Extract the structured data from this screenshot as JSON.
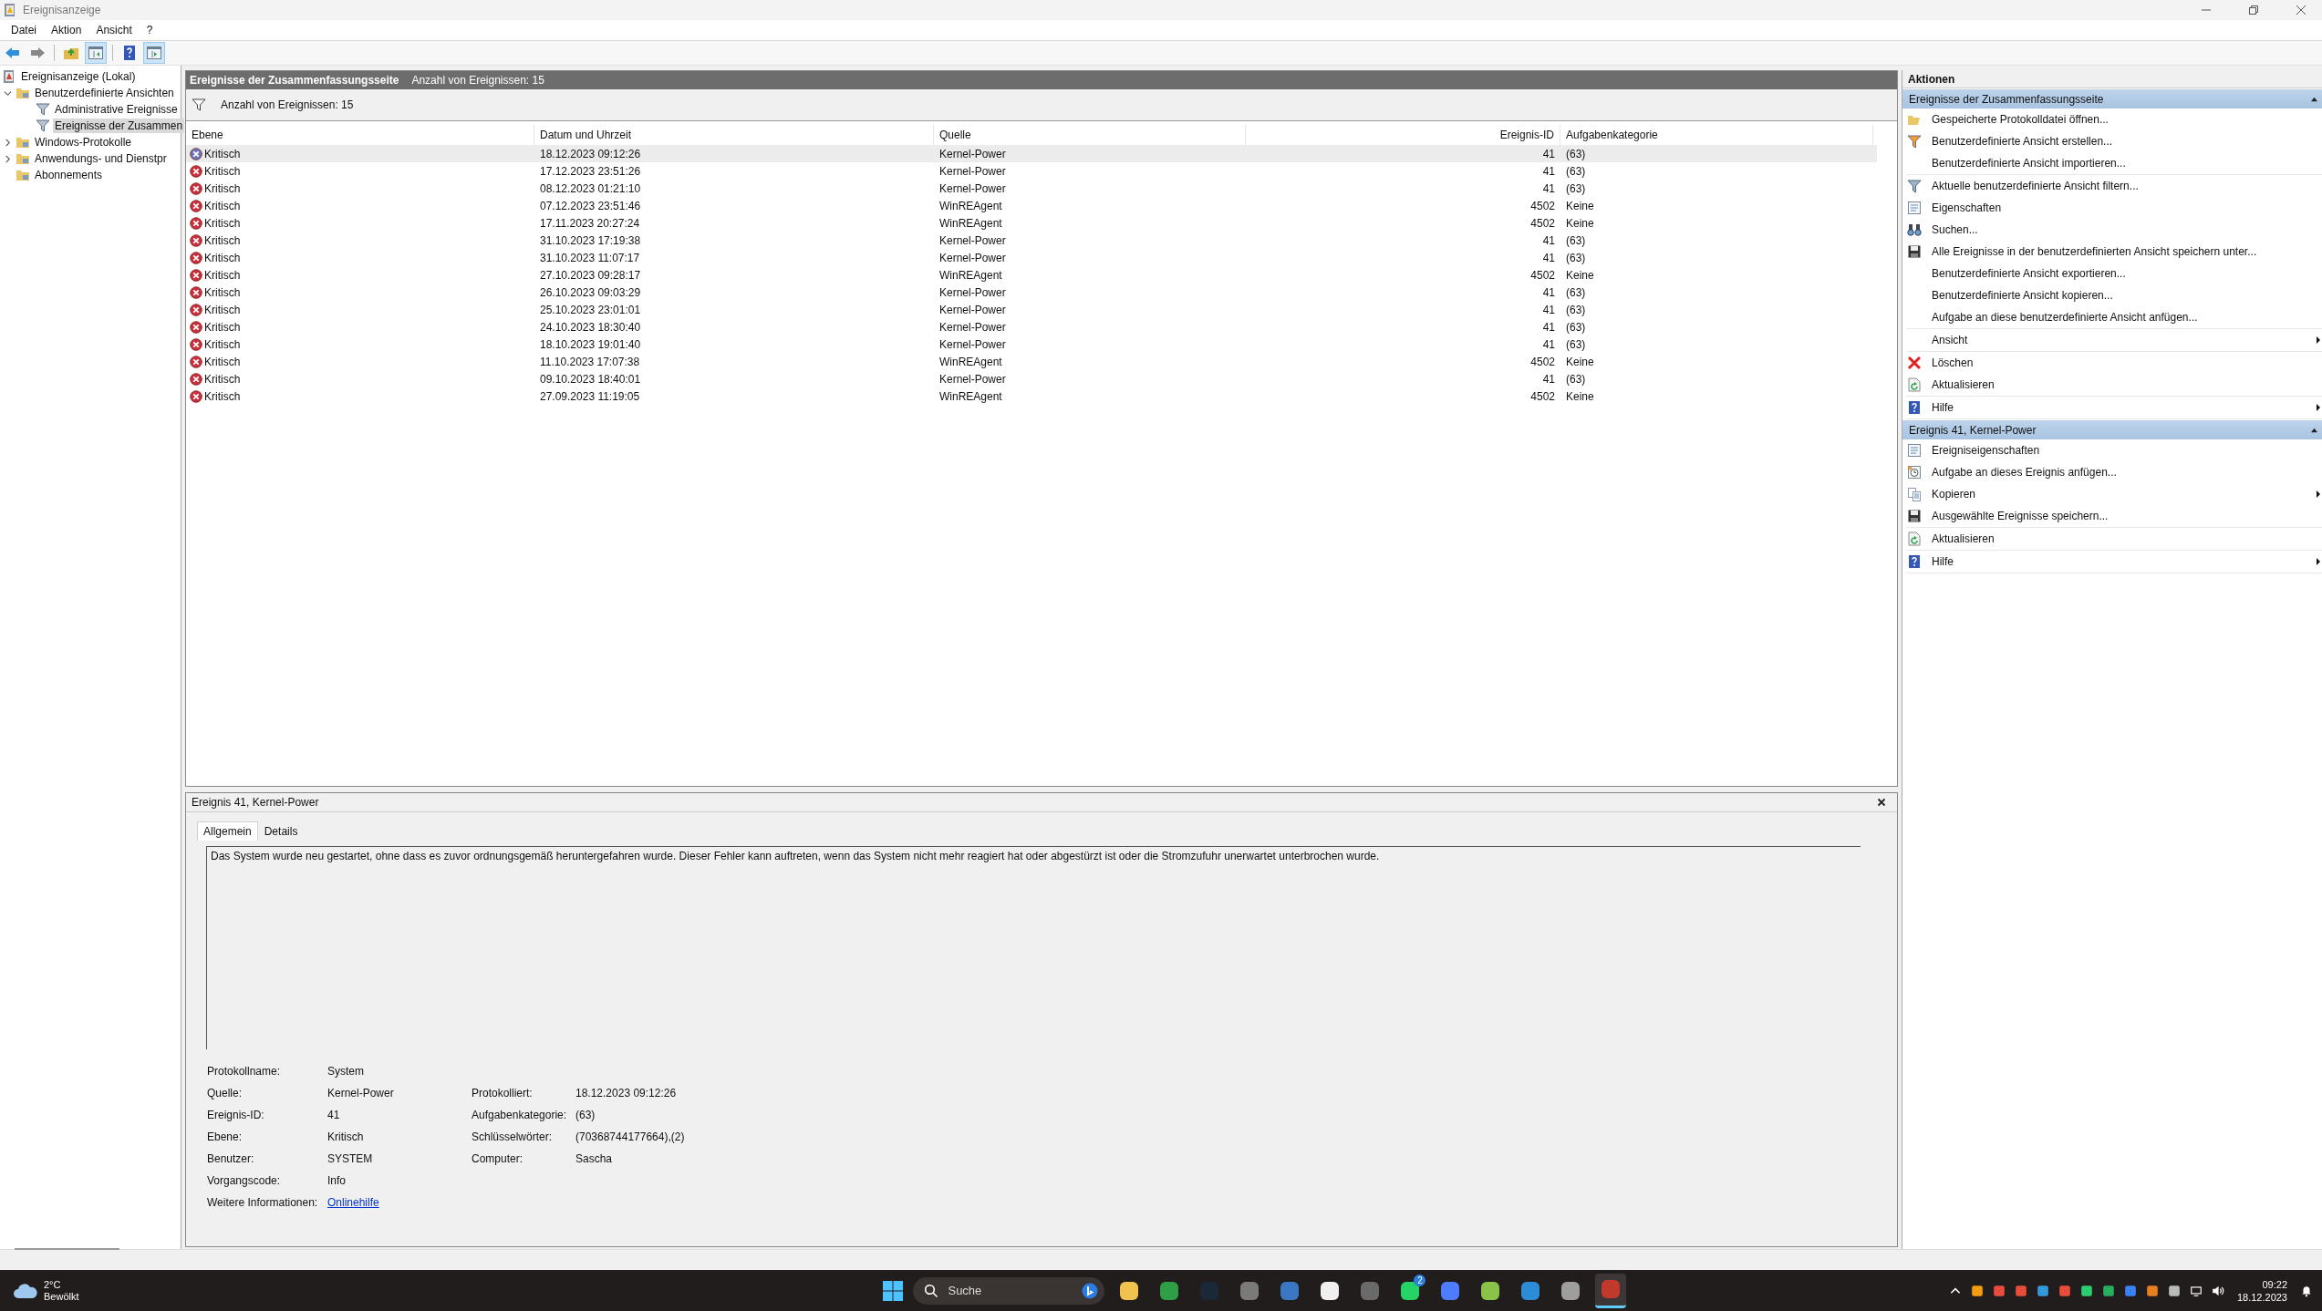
{
  "window": {
    "title": "Ereignisanzeige"
  },
  "menu": [
    "Datei",
    "Aktion",
    "Ansicht",
    "?"
  ],
  "toolbar": [
    {
      "kind": "back",
      "pressed": false
    },
    {
      "kind": "forward",
      "pressed": false
    },
    {
      "kind": "up",
      "pressed": false
    },
    {
      "kind": "tree-pane",
      "pressed": true
    },
    {
      "kind": "help",
      "pressed": false
    },
    {
      "kind": "action-pane",
      "pressed": true
    }
  ],
  "tree": [
    {
      "label": "Ereignisanzeige (Lokal)",
      "kind": "root",
      "selected": false,
      "children": [
        {
          "label": "Benutzerdefinierte Ansichten",
          "kind": "folder",
          "expanded": true,
          "selected": false,
          "children": [
            {
              "label": "Administrative Ereignisse",
              "kind": "funnel",
              "selected": false
            },
            {
              "label": "Ereignisse der Zusammen",
              "kind": "funnel",
              "selected": true
            }
          ]
        },
        {
          "label": "Windows-Protokolle",
          "kind": "folder",
          "expanded": false,
          "selected": false
        },
        {
          "label": "Anwendungs- und Dienstpr",
          "kind": "folder",
          "expanded": false,
          "selected": false
        },
        {
          "label": "Abonnements",
          "kind": "folder",
          "selected": false
        }
      ]
    }
  ],
  "view": {
    "title": "Ereignisse der Zusammenfassungsseite",
    "count": "Anzahl von Ereignissen: 15",
    "filter_text": "Anzahl von Ereignissen: 15"
  },
  "table": {
    "columns": [
      {
        "label": "Ebene",
        "numeric": false
      },
      {
        "label": "Datum und Uhrzeit",
        "numeric": false
      },
      {
        "label": "Quelle",
        "numeric": false
      },
      {
        "label": "Ereignis-ID",
        "numeric": true
      },
      {
        "label": "Aufgabenkategorie",
        "numeric": false
      }
    ],
    "rows": [
      {
        "severity": "Kritisch",
        "date": "18.12.2023 09:12:26",
        "source": "Kernel-Power",
        "id": "41",
        "category": "(63)",
        "selected": true
      },
      {
        "severity": "Kritisch",
        "date": "17.12.2023 23:51:26",
        "source": "Kernel-Power",
        "id": "41",
        "category": "(63)",
        "selected": false
      },
      {
        "severity": "Kritisch",
        "date": "08.12.2023 01:21:10",
        "source": "Kernel-Power",
        "id": "41",
        "category": "(63)",
        "selected": false
      },
      {
        "severity": "Kritisch",
        "date": "07.12.2023 23:51:46",
        "source": "WinREAgent",
        "id": "4502",
        "category": "Keine",
        "selected": false
      },
      {
        "severity": "Kritisch",
        "date": "17.11.2023 20:27:24",
        "source": "WinREAgent",
        "id": "4502",
        "category": "Keine",
        "selected": false
      },
      {
        "severity": "Kritisch",
        "date": "31.10.2023 17:19:38",
        "source": "Kernel-Power",
        "id": "41",
        "category": "(63)",
        "selected": false
      },
      {
        "severity": "Kritisch",
        "date": "31.10.2023 11:07:17",
        "source": "Kernel-Power",
        "id": "41",
        "category": "(63)",
        "selected": false
      },
      {
        "severity": "Kritisch",
        "date": "27.10.2023 09:28:17",
        "source": "WinREAgent",
        "id": "4502",
        "category": "Keine",
        "selected": false
      },
      {
        "severity": "Kritisch",
        "date": "26.10.2023 09:03:29",
        "source": "Kernel-Power",
        "id": "41",
        "category": "(63)",
        "selected": false
      },
      {
        "severity": "Kritisch",
        "date": "25.10.2023 23:01:01",
        "source": "Kernel-Power",
        "id": "41",
        "category": "(63)",
        "selected": false
      },
      {
        "severity": "Kritisch",
        "date": "24.10.2023 18:30:40",
        "source": "Kernel-Power",
        "id": "41",
        "category": "(63)",
        "selected": false
      },
      {
        "severity": "Kritisch",
        "date": "18.10.2023 19:01:40",
        "source": "Kernel-Power",
        "id": "41",
        "category": "(63)",
        "selected": false
      },
      {
        "severity": "Kritisch",
        "date": "11.10.2023 17:07:38",
        "source": "WinREAgent",
        "id": "4502",
        "category": "Keine",
        "selected": false
      },
      {
        "severity": "Kritisch",
        "date": "09.10.2023 18:40:01",
        "source": "Kernel-Power",
        "id": "41",
        "category": "(63)",
        "selected": false
      },
      {
        "severity": "Kritisch",
        "date": "27.09.2023 11:19:05",
        "source": "WinREAgent",
        "id": "4502",
        "category": "Keine",
        "selected": false
      }
    ]
  },
  "detail": {
    "title": "Ereignis 41, Kernel-Power",
    "tabs": [
      {
        "label": "Allgemein",
        "selected": true
      },
      {
        "label": "Details",
        "selected": false
      }
    ],
    "description": "Das System wurde neu gestartet, ohne dass es zuvor ordnungsgemäß heruntergefahren wurde. Dieser Fehler kann auftreten, wenn das System nicht mehr reagiert hat oder abgestürzt ist oder die Stromzufuhr unerwartet unterbrochen wurde.",
    "rows": [
      {
        "left": {
          "label": "Protokollname:",
          "value": "System"
        }
      },
      {
        "left": {
          "label": "Quelle:",
          "value": "Kernel-Power"
        },
        "right": {
          "label": "Protokolliert:",
          "value": "18.12.2023 09:12:26"
        }
      },
      {
        "left": {
          "label": "Ereignis-ID:",
          "value": "41"
        },
        "right": {
          "label": "Aufgabenkategorie:",
          "value": "(63)"
        }
      },
      {
        "left": {
          "label": "Ebene:",
          "value": "Kritisch"
        },
        "right": {
          "label": "Schlüsselwörter:",
          "value": "(70368744177664),(2)"
        }
      },
      {
        "left": {
          "label": "Benutzer:",
          "value": "SYSTEM"
        },
        "right": {
          "label": "Computer:",
          "value": "Sascha"
        }
      },
      {
        "left": {
          "label": "Vorgangscode:",
          "value": "Info"
        }
      },
      {
        "left": {
          "label": "Weitere Informationen:",
          "value": "Onlinehilfe",
          "link": true
        }
      }
    ]
  },
  "actions": {
    "title": "Aktionen",
    "sections": [
      {
        "title": "Ereignisse der Zusammenfassungsseite",
        "expanded": true,
        "groups": [
          [
            {
              "label": "Gespeicherte Protokolldatei öffnen...",
              "kind": "folder",
              "submenu": false
            },
            {
              "label": "Benutzerdefinierte Ansicht erstellen...",
              "kind": "funnel-color",
              "submenu": false
            },
            {
              "label": "Benutzerdefinierte Ansicht importieren...",
              "kind": "none",
              "submenu": false
            }
          ],
          [
            {
              "label": "Aktuelle benutzerdefinierte Ansicht filtern...",
              "kind": "funnel",
              "submenu": false
            },
            {
              "label": "Eigenschaften",
              "kind": "properties",
              "submenu": false
            },
            {
              "label": "Suchen...",
              "kind": "binoculars",
              "submenu": false
            },
            {
              "label": "Alle Ereignisse in der benutzerdefinierten Ansicht speichern unter...",
              "kind": "disk",
              "submenu": false
            },
            {
              "label": "Benutzerdefinierte Ansicht exportieren...",
              "kind": "none",
              "submenu": false
            },
            {
              "label": "Benutzerdefinierte Ansicht kopieren...",
              "kind": "none",
              "submenu": false
            },
            {
              "label": "Aufgabe an diese benutzerdefinierte Ansicht anfügen...",
              "kind": "none",
              "submenu": false
            }
          ],
          [
            {
              "label": "Ansicht",
              "kind": "none",
              "submenu": true
            }
          ],
          [
            {
              "label": "Löschen",
              "kind": "delete",
              "submenu": false
            },
            {
              "label": "Aktualisieren",
              "kind": "refresh",
              "submenu": false
            }
          ],
          [
            {
              "label": "Hilfe",
              "kind": "help",
              "submenu": true
            }
          ]
        ]
      },
      {
        "title": "Ereignis 41, Kernel-Power",
        "expanded": true,
        "groups": [
          [
            {
              "label": "Ereigniseigenschaften",
              "kind": "properties",
              "submenu": false
            },
            {
              "label": "Aufgabe an dieses Ereignis anfügen...",
              "kind": "task",
              "submenu": false
            },
            {
              "label": "Kopieren",
              "kind": "copy",
              "submenu": true
            },
            {
              "label": "Ausgewählte Ereignisse speichern...",
              "kind": "disk",
              "submenu": false
            }
          ],
          [
            {
              "label": "Aktualisieren",
              "kind": "refresh",
              "submenu": false
            }
          ],
          [
            {
              "label": "Hilfe",
              "kind": "help",
              "submenu": true
            }
          ]
        ]
      }
    ]
  },
  "taskbar": {
    "temperature": "2°C",
    "weather": "Bewölkt",
    "search_placeholder": "Suche",
    "apps": [
      {
        "color": "#f2c14e",
        "active": false
      },
      {
        "color": "#2f9e44",
        "active": false
      },
      {
        "color": "#1b2838",
        "active": false
      },
      {
        "color": "#7a7a7a",
        "active": false
      },
      {
        "color": "#3b78c4",
        "active": false
      },
      {
        "color": "#f0f0f0",
        "active": false
      },
      {
        "color": "#6a6a6a",
        "active": false
      },
      {
        "color": "#25d366",
        "active": false,
        "badge": "2"
      },
      {
        "color": "#4d7cfe",
        "active": false
      },
      {
        "color": "#8bc34a",
        "active": false
      },
      {
        "color": "#2d8cd6",
        "active": false
      },
      {
        "color": "#9e9e9e",
        "active": false
      },
      {
        "color": "#c0392b",
        "active": true
      }
    ],
    "time": "09:22",
    "date": "18.12.2023"
  }
}
